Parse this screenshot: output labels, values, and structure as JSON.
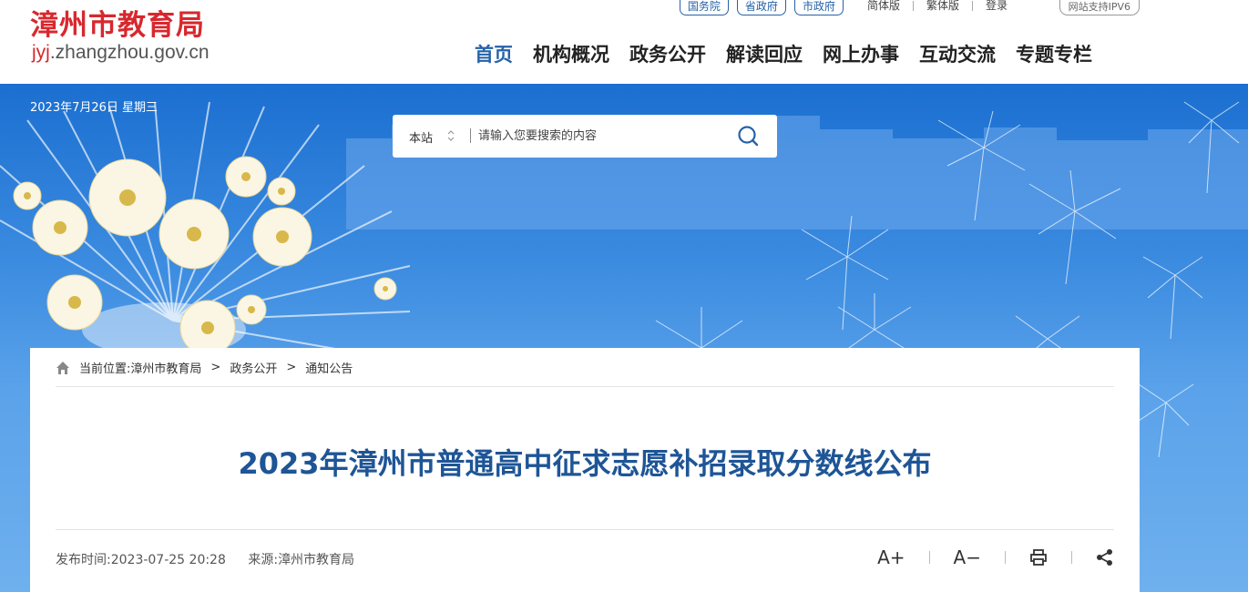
{
  "header": {
    "logo_title": "漳州市教育局",
    "logo_url_prefix": "jyj",
    "logo_url_rest": ".zhangzhou.gov.cn",
    "top_links": [
      "国务院",
      "省政府",
      "市政府"
    ],
    "lang_simplified": "简体版",
    "lang_traditional": "繁体版",
    "login": "登录",
    "ipv6_badge": "网站支持IPV6",
    "nav": [
      "首页",
      "机构概况",
      "政务公开",
      "解读回应",
      "网上办事",
      "互动交流",
      "专题专栏"
    ]
  },
  "banner": {
    "date": "2023年7月26日 星期三"
  },
  "search": {
    "scope": "本站",
    "placeholder": "请输入您要搜索的内容"
  },
  "breadcrumb": {
    "prefix": "当前位置:",
    "items": [
      "漳州市教育局",
      "政务公开",
      "通知公告"
    ],
    "separator": ">"
  },
  "article": {
    "title": "2023年漳州市普通高中征求志愿补招录取分数线公布",
    "publish_label": "发布时间:",
    "publish_time": "2023-07-25 20:28",
    "source_label": "来源:",
    "source": "漳州市教育局"
  },
  "tools": {
    "font_larger": "A+",
    "font_smaller": "A−"
  },
  "colors": {
    "brand_red": "#d7282e",
    "nav_active": "#2662a8",
    "title_blue": "#1e5596",
    "banner_blue": "#1b6fd0"
  },
  "icons": [
    "home-icon",
    "search-icon",
    "select-arrows-icon",
    "print-icon",
    "share-icon"
  ]
}
